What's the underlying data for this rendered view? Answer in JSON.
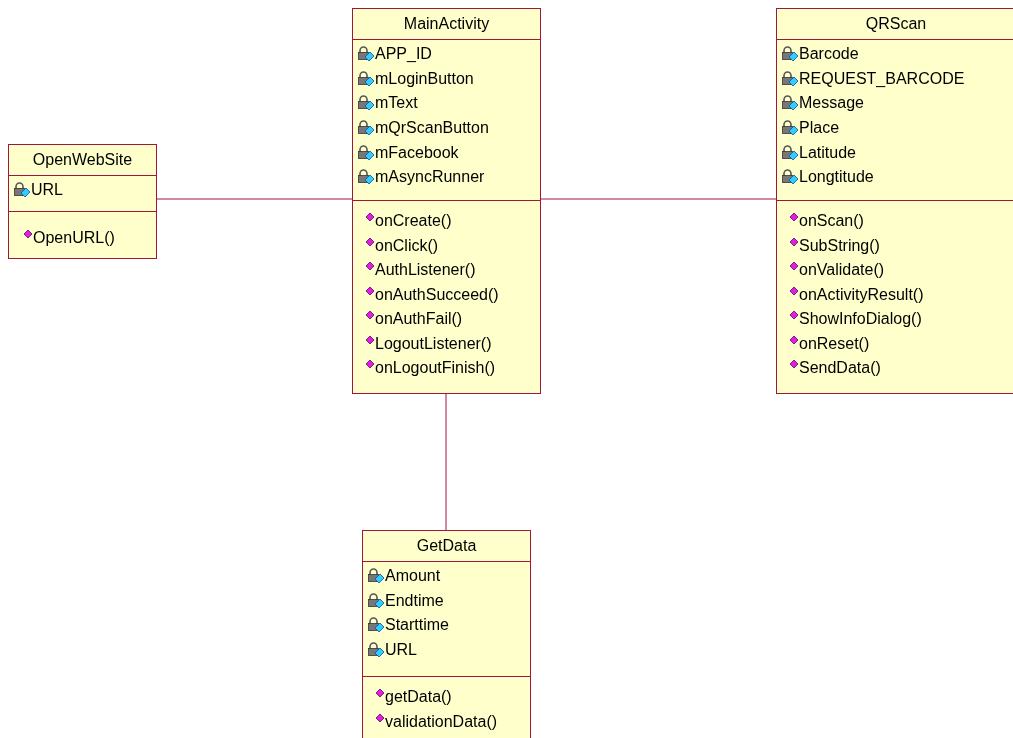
{
  "classes": [
    {
      "name": "OpenWebSite",
      "attributes": [
        "URL"
      ],
      "operations": [
        "OpenURL()"
      ]
    },
    {
      "name": "MainActivity",
      "attributes": [
        "APP_ID",
        "mLoginButton",
        "mText",
        "mQrScanButton",
        "mFacebook",
        "mAsyncRunner"
      ],
      "operations": [
        "onCreate()",
        "onClick()",
        "AuthListener()",
        "onAuthSucceed()",
        "onAuthFail()",
        "LogoutListener()",
        "onLogoutFinish()"
      ]
    },
    {
      "name": "QRScan",
      "attributes": [
        "Barcode",
        "REQUEST_BARCODE",
        "Message",
        "Place",
        "Latitude",
        "Longtitude"
      ],
      "operations": [
        "onScan()",
        "SubString()",
        "onValidate()",
        "onActivityResult()",
        "ShowInfoDialog()",
        "onReset()",
        "SendData()"
      ]
    },
    {
      "name": "GetData",
      "attributes": [
        "Amount",
        "Endtime",
        "Starttime",
        "URL"
      ],
      "operations": [
        "getData()",
        "validationData()"
      ]
    }
  ]
}
